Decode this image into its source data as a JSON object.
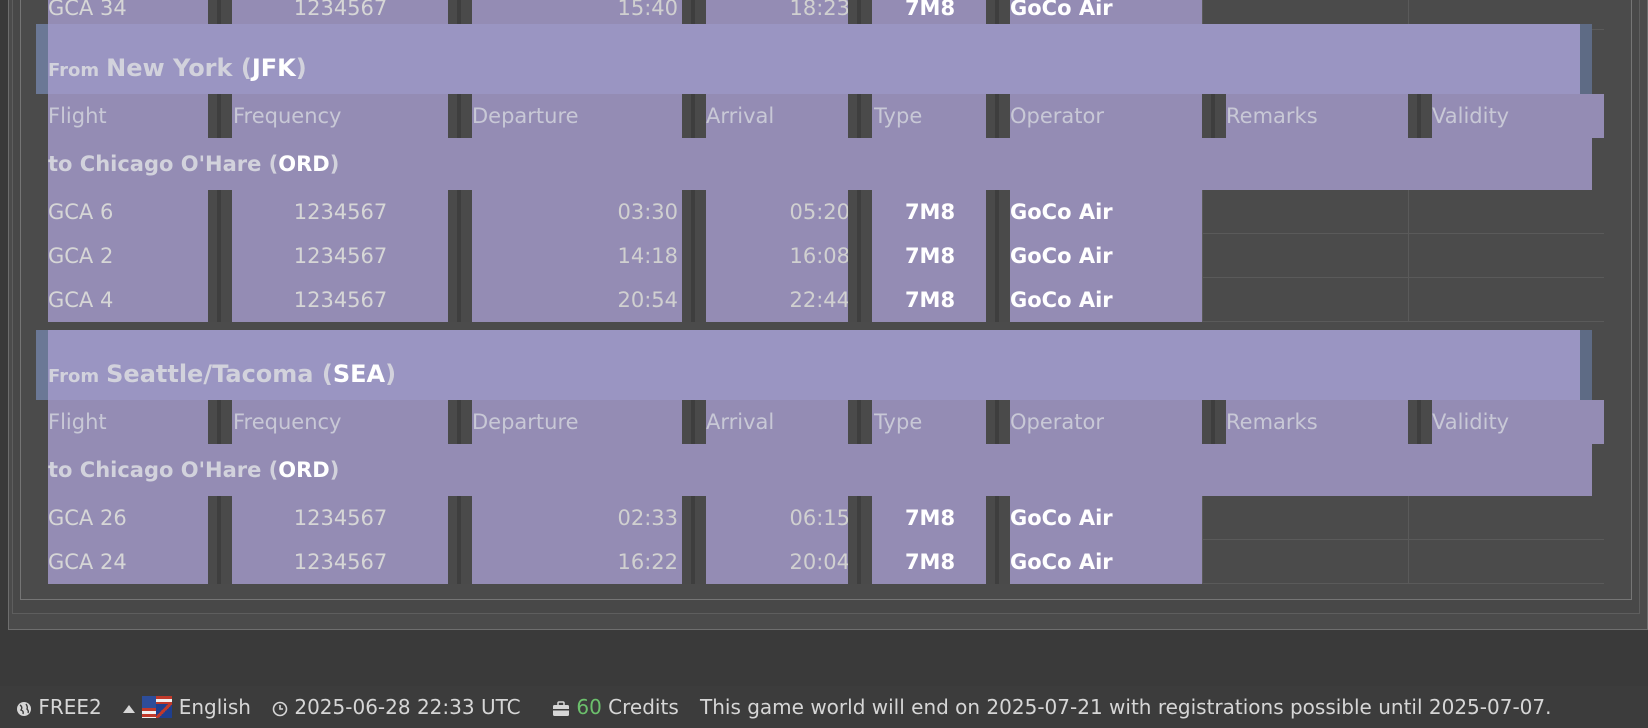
{
  "columns": {
    "flight": "Flight",
    "frequency": "Frequency",
    "departure": "Departure",
    "arrival": "Arrival",
    "type": "Type",
    "operator": "Operator",
    "remarks": "Remarks",
    "validity": "Validity"
  },
  "top_partial_row": {
    "flight": "GCA 34",
    "frequency": "1234567",
    "departure": "15:40",
    "arrival": "18:23",
    "type": "7M8",
    "operator": "GoCo Air"
  },
  "groups": [
    {
      "from_prefix": "From",
      "from_city": "New York",
      "from_code": "JFK",
      "to_prefix": "to",
      "to_city": "Chicago O'Hare",
      "to_code": "ORD",
      "flights": [
        {
          "flight": "GCA 6",
          "frequency": "1234567",
          "departure": "03:30",
          "arrival": "05:20",
          "type": "7M8",
          "operator": "GoCo Air"
        },
        {
          "flight": "GCA 2",
          "frequency": "1234567",
          "departure": "14:18",
          "arrival": "16:08",
          "type": "7M8",
          "operator": "GoCo Air"
        },
        {
          "flight": "GCA 4",
          "frequency": "1234567",
          "departure": "20:54",
          "arrival": "22:44",
          "type": "7M8",
          "operator": "GoCo Air"
        }
      ]
    },
    {
      "from_prefix": "From",
      "from_city": "Seattle/Tacoma",
      "from_code": "SEA",
      "to_prefix": "to",
      "to_city": "Chicago O'Hare",
      "to_code": "ORD",
      "flights": [
        {
          "flight": "GCA 26",
          "frequency": "1234567",
          "departure": "02:33",
          "arrival": "06:15",
          "type": "7M8",
          "operator": "GoCo Air"
        },
        {
          "flight": "GCA 24",
          "frequency": "1234567",
          "departure": "16:22",
          "arrival": "20:04",
          "type": "7M8",
          "operator": "GoCo Air"
        }
      ]
    }
  ],
  "statusbar": {
    "world_icon": "globe-icon",
    "world": "FREE2",
    "language_icon": "triangle-up-icon",
    "flag_icon": "us-uk-flag-icon",
    "language": "English",
    "clock_icon": "clock-icon",
    "datetime": "2025-06-28 22:33 UTC",
    "briefcase_icon": "briefcase-icon",
    "credits_count": "60",
    "credits_label": "Credits",
    "message": "This game world will end on 2025-07-21 with registrations possible until 2025-07-07."
  },
  "colors": {
    "row_purple": "#948cb4",
    "group_header": "#9a95c2",
    "credits_green": "#6cc06c",
    "background": "#3a3a3a"
  }
}
